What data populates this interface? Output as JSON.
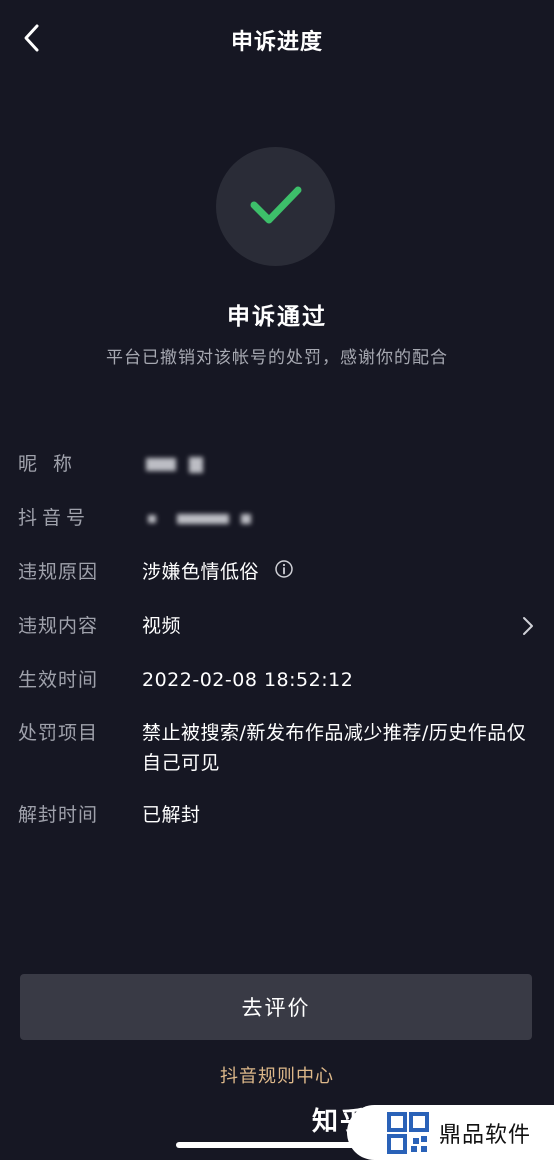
{
  "header": {
    "title": "申诉进度"
  },
  "status": {
    "title": "申诉通过",
    "description": "平台已撤销对该帐号的处罚，感谢你的配合",
    "accent_color": "#3dbf6a"
  },
  "details": {
    "nickname_label": "昵 称",
    "douyin_id_label": "抖音号",
    "violation_reason_label": "违规原因",
    "violation_reason_value": "涉嫌色情低俗",
    "violation_content_label": "违规内容",
    "violation_content_value": "视频",
    "effective_time_label": "生效时间",
    "effective_time_value": "2022-02-08 18:52:12",
    "penalty_label": "处罚项目",
    "penalty_value": "禁止被搜索/新发布作品减少推荐/历史作品仅自己可见",
    "unban_time_label": "解封时间",
    "unban_time_value": "已解封"
  },
  "actions": {
    "rate_button": "去评价",
    "rules_link": "抖音规则中心"
  },
  "watermarks": {
    "zhihu": "知乎",
    "brand_name": "鼎品软件"
  },
  "icons": {
    "back": "chevron-left-icon",
    "check": "check-icon",
    "info": "info-circle-icon",
    "more": "chevron-right-icon",
    "brand": "qr-logo-icon"
  }
}
